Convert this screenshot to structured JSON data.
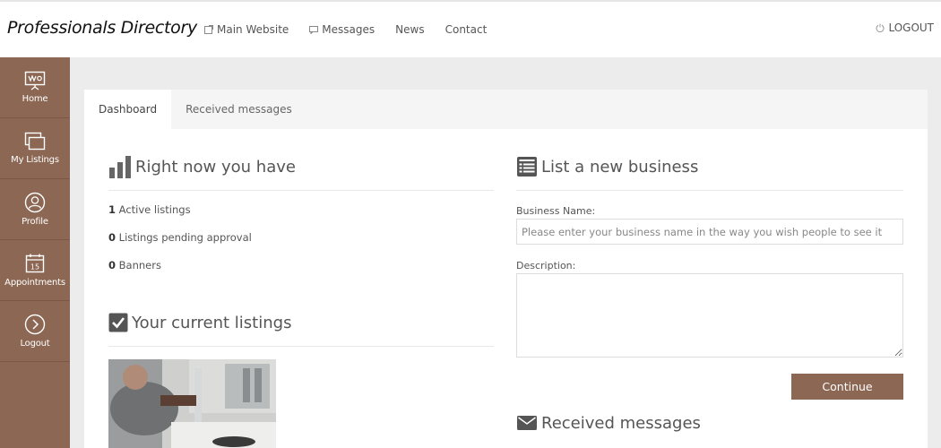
{
  "header": {
    "brand": "Professionals Directory",
    "nav": [
      {
        "label": "Main Website",
        "icon": "external-page-icon"
      },
      {
        "label": "Messages",
        "icon": "chat-icon"
      },
      {
        "label": "News"
      },
      {
        "label": "Contact"
      }
    ],
    "logout": "LOGOUT"
  },
  "sidebar": {
    "items": [
      {
        "label": "Home",
        "icon": "presentation-board-icon"
      },
      {
        "label": "My Listings",
        "icon": "windows-stack-icon"
      },
      {
        "label": "Profile",
        "icon": "user-circle-icon"
      },
      {
        "label": "Appointments",
        "icon": "calendar-icon",
        "calendar_day": "15"
      },
      {
        "label": "Logout",
        "icon": "chevron-circle-right-icon"
      }
    ]
  },
  "tabs": [
    {
      "label": "Dashboard",
      "active": true
    },
    {
      "label": "Received messages",
      "active": false
    }
  ],
  "summary": {
    "title": "Right now you have",
    "stats": [
      {
        "count": "1",
        "label": "Active listings"
      },
      {
        "count": "0",
        "label": "Listings pending approval"
      },
      {
        "count": "0",
        "label": "Banners"
      }
    ]
  },
  "listings": {
    "title": "Your current listings"
  },
  "new_business": {
    "title": "List a new business",
    "name_label": "Business Name:",
    "name_placeholder": "Please enter your business name in the way you wish people to see it",
    "description_label": "Description:",
    "continue_label": "Continue"
  },
  "messages": {
    "title": "Received messages"
  },
  "colors": {
    "accent": "#8c6753",
    "background": "#ececec"
  }
}
